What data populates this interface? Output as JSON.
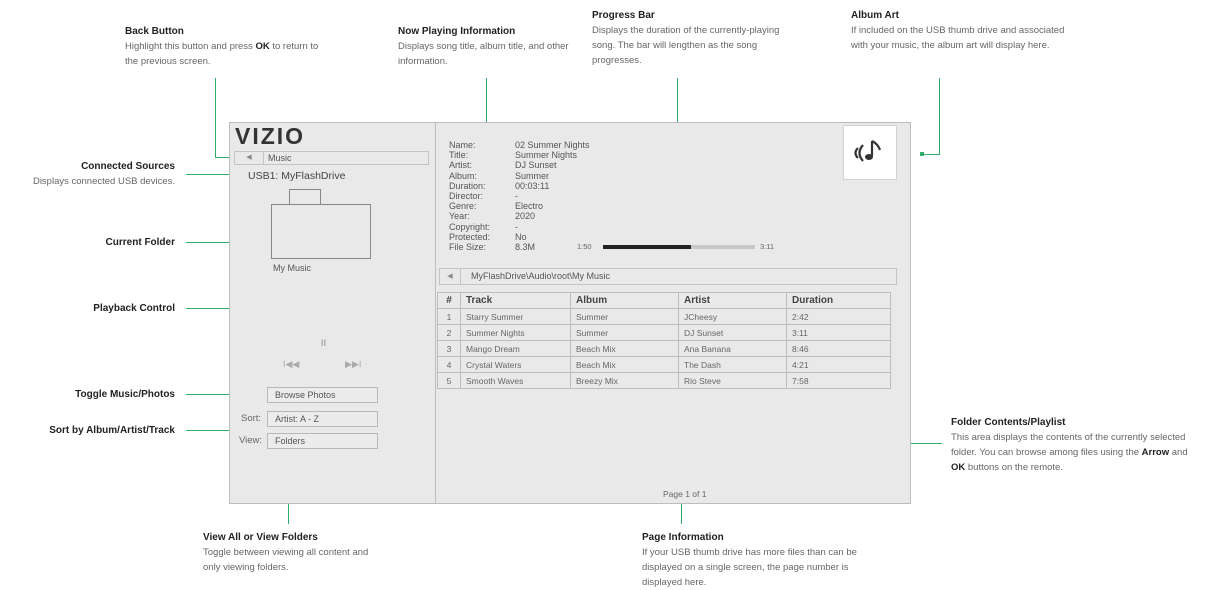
{
  "annotations": {
    "back_button": {
      "title": "Back Button",
      "text_1": "Highlight this button and press ",
      "bold": "OK",
      "text_2": " to return to the previous screen."
    },
    "now_playing": {
      "title": "Now Playing Information",
      "text": "Displays song title, album title, and other information."
    },
    "progress_bar": {
      "title": "Progress Bar",
      "text": "Displays the duration of the currently-playing song. The bar will lengthen as the song progresses."
    },
    "album_art": {
      "title": "Album Art",
      "text": "If included on the USB thumb drive and associated with your music, the album art will display here."
    },
    "connected_sources": {
      "title": "Connected Sources",
      "text": "Displays connected USB devices."
    },
    "current_folder": {
      "title": "Current Folder"
    },
    "playback_control": {
      "title": "Playback Control"
    },
    "toggle": {
      "title": "Toggle Music/Photos"
    },
    "sort": {
      "title": "Sort by Album/Artist/Track"
    },
    "view": {
      "title": "View All or View Folders",
      "text": "Toggle between viewing all content and only viewing folders."
    },
    "folder_contents": {
      "title": "Folder Contents/Playlist",
      "text_1": "This area displays the contents of the currently selected folder. You can browse among files using the ",
      "bold_1": "Arrow",
      "text_2": " and ",
      "bold_2": "OK",
      "text_3": " buttons on the remote."
    },
    "page_info": {
      "title": "Page Information",
      "text": "If your USB thumb drive has more files than can be displayed on a single screen, the page number is displayed here."
    }
  },
  "screen": {
    "logo": "VIZIO",
    "back_label": "Music",
    "source": "USB1: MyFlashDrive",
    "folder_name": "My Music",
    "pause_glyph": "II",
    "prev_glyph": "I◀◀",
    "next_glyph": "▶▶I",
    "browse_button": "Browse Photos",
    "sort_label": "Sort:",
    "sort_value": "Artist: A - Z",
    "view_label": "View:",
    "view_value": "Folders",
    "info": [
      {
        "key": "Name:",
        "value": "02 Summer Nights"
      },
      {
        "key": "Title:",
        "value": "Summer Nights"
      },
      {
        "key": "Artist:",
        "value": "DJ Sunset"
      },
      {
        "key": "Album:",
        "value": "Summer"
      },
      {
        "key": "Duration:",
        "value": "00:03:11"
      },
      {
        "key": "Director:",
        "value": "-"
      },
      {
        "key": "Genre:",
        "value": "Electro"
      },
      {
        "key": "Year:",
        "value": "2020"
      },
      {
        "key": "Copyright:",
        "value": "-"
      },
      {
        "key": "Protected:",
        "value": "No"
      },
      {
        "key": "File Size:",
        "value": "8.3M"
      }
    ],
    "progress_start": "1:50",
    "progress_end": "3:11",
    "progress_fraction": 0.58,
    "path": "MyFlashDrive\\Audio\\root\\My Music",
    "columns": [
      "#",
      "Track",
      "Album",
      "Artist",
      "Duration"
    ],
    "rows": [
      [
        "1",
        "Starry Summer",
        "Summer",
        "JCheesy",
        "2:42"
      ],
      [
        "2",
        "Summer Nights",
        "Summer",
        "DJ Sunset",
        "3:11"
      ],
      [
        "3",
        "Mango Dream",
        "Beach Mix",
        "Ana Banana",
        "8:46"
      ],
      [
        "4",
        "Crystal Waters",
        "Beach Mix",
        "The Dash",
        "4:21"
      ],
      [
        "5",
        "Smooth Waves",
        "Breezy Mix",
        "Rio Steve",
        "7:58"
      ]
    ],
    "page": "Page 1 of 1"
  },
  "colors": {
    "accent": "#2fae6a",
    "screen_bg": "#e9e9e9",
    "progress_fill": "#222222"
  }
}
